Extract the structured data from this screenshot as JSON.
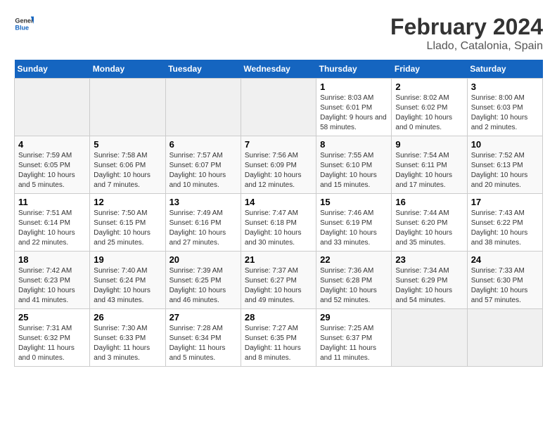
{
  "header": {
    "logo_general": "General",
    "logo_blue": "Blue",
    "title": "February 2024",
    "subtitle": "Llado, Catalonia, Spain"
  },
  "calendar": {
    "days_of_week": [
      "Sunday",
      "Monday",
      "Tuesday",
      "Wednesday",
      "Thursday",
      "Friday",
      "Saturday"
    ],
    "weeks": [
      [
        {
          "day": "",
          "info": ""
        },
        {
          "day": "",
          "info": ""
        },
        {
          "day": "",
          "info": ""
        },
        {
          "day": "",
          "info": ""
        },
        {
          "day": "1",
          "info": "Sunrise: 8:03 AM\nSunset: 6:01 PM\nDaylight: 9 hours and 58 minutes."
        },
        {
          "day": "2",
          "info": "Sunrise: 8:02 AM\nSunset: 6:02 PM\nDaylight: 10 hours and 0 minutes."
        },
        {
          "day": "3",
          "info": "Sunrise: 8:00 AM\nSunset: 6:03 PM\nDaylight: 10 hours and 2 minutes."
        }
      ],
      [
        {
          "day": "4",
          "info": "Sunrise: 7:59 AM\nSunset: 6:05 PM\nDaylight: 10 hours and 5 minutes."
        },
        {
          "day": "5",
          "info": "Sunrise: 7:58 AM\nSunset: 6:06 PM\nDaylight: 10 hours and 7 minutes."
        },
        {
          "day": "6",
          "info": "Sunrise: 7:57 AM\nSunset: 6:07 PM\nDaylight: 10 hours and 10 minutes."
        },
        {
          "day": "7",
          "info": "Sunrise: 7:56 AM\nSunset: 6:09 PM\nDaylight: 10 hours and 12 minutes."
        },
        {
          "day": "8",
          "info": "Sunrise: 7:55 AM\nSunset: 6:10 PM\nDaylight: 10 hours and 15 minutes."
        },
        {
          "day": "9",
          "info": "Sunrise: 7:54 AM\nSunset: 6:11 PM\nDaylight: 10 hours and 17 minutes."
        },
        {
          "day": "10",
          "info": "Sunrise: 7:52 AM\nSunset: 6:13 PM\nDaylight: 10 hours and 20 minutes."
        }
      ],
      [
        {
          "day": "11",
          "info": "Sunrise: 7:51 AM\nSunset: 6:14 PM\nDaylight: 10 hours and 22 minutes."
        },
        {
          "day": "12",
          "info": "Sunrise: 7:50 AM\nSunset: 6:15 PM\nDaylight: 10 hours and 25 minutes."
        },
        {
          "day": "13",
          "info": "Sunrise: 7:49 AM\nSunset: 6:16 PM\nDaylight: 10 hours and 27 minutes."
        },
        {
          "day": "14",
          "info": "Sunrise: 7:47 AM\nSunset: 6:18 PM\nDaylight: 10 hours and 30 minutes."
        },
        {
          "day": "15",
          "info": "Sunrise: 7:46 AM\nSunset: 6:19 PM\nDaylight: 10 hours and 33 minutes."
        },
        {
          "day": "16",
          "info": "Sunrise: 7:44 AM\nSunset: 6:20 PM\nDaylight: 10 hours and 35 minutes."
        },
        {
          "day": "17",
          "info": "Sunrise: 7:43 AM\nSunset: 6:22 PM\nDaylight: 10 hours and 38 minutes."
        }
      ],
      [
        {
          "day": "18",
          "info": "Sunrise: 7:42 AM\nSunset: 6:23 PM\nDaylight: 10 hours and 41 minutes."
        },
        {
          "day": "19",
          "info": "Sunrise: 7:40 AM\nSunset: 6:24 PM\nDaylight: 10 hours and 43 minutes."
        },
        {
          "day": "20",
          "info": "Sunrise: 7:39 AM\nSunset: 6:25 PM\nDaylight: 10 hours and 46 minutes."
        },
        {
          "day": "21",
          "info": "Sunrise: 7:37 AM\nSunset: 6:27 PM\nDaylight: 10 hours and 49 minutes."
        },
        {
          "day": "22",
          "info": "Sunrise: 7:36 AM\nSunset: 6:28 PM\nDaylight: 10 hours and 52 minutes."
        },
        {
          "day": "23",
          "info": "Sunrise: 7:34 AM\nSunset: 6:29 PM\nDaylight: 10 hours and 54 minutes."
        },
        {
          "day": "24",
          "info": "Sunrise: 7:33 AM\nSunset: 6:30 PM\nDaylight: 10 hours and 57 minutes."
        }
      ],
      [
        {
          "day": "25",
          "info": "Sunrise: 7:31 AM\nSunset: 6:32 PM\nDaylight: 11 hours and 0 minutes."
        },
        {
          "day": "26",
          "info": "Sunrise: 7:30 AM\nSunset: 6:33 PM\nDaylight: 11 hours and 3 minutes."
        },
        {
          "day": "27",
          "info": "Sunrise: 7:28 AM\nSunset: 6:34 PM\nDaylight: 11 hours and 5 minutes."
        },
        {
          "day": "28",
          "info": "Sunrise: 7:27 AM\nSunset: 6:35 PM\nDaylight: 11 hours and 8 minutes."
        },
        {
          "day": "29",
          "info": "Sunrise: 7:25 AM\nSunset: 6:37 PM\nDaylight: 11 hours and 11 minutes."
        },
        {
          "day": "",
          "info": ""
        },
        {
          "day": "",
          "info": ""
        }
      ]
    ]
  }
}
